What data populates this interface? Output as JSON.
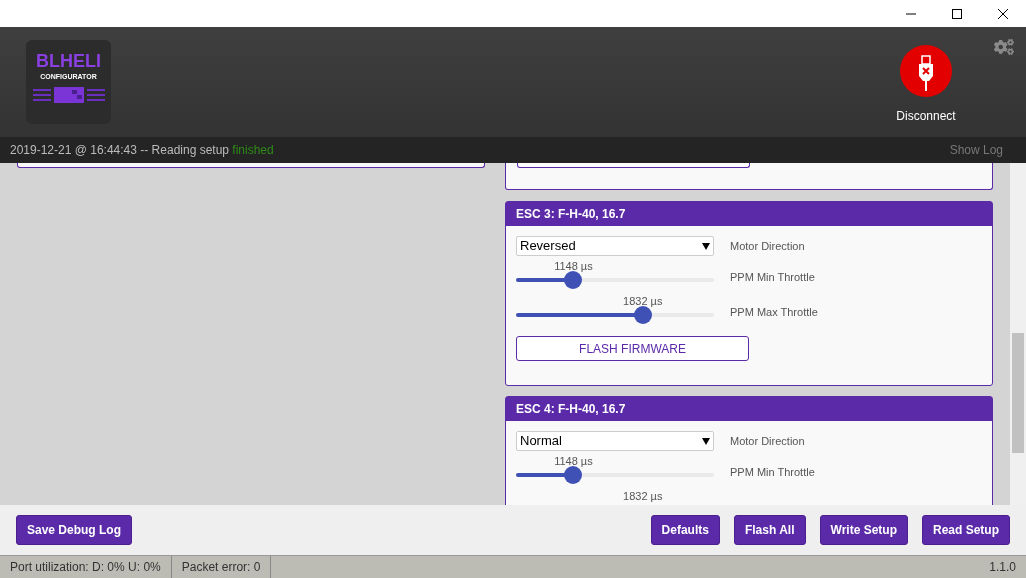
{
  "header": {
    "logo": {
      "title": "BLHELI",
      "subtitle": "CONFIGURATOR"
    },
    "connect_button": {
      "label": "Disconnect",
      "connected": true
    }
  },
  "log_bar": {
    "timestamp": "2019-12-21 @ 16:44:43",
    "message": "-- Reading setup",
    "status": "finished",
    "show_log": "Show Log"
  },
  "escs": [
    {
      "title": "ESC 3: F-H-40, 16.7",
      "direction": {
        "value": "Reversed",
        "label": "Motor Direction"
      },
      "sliders": [
        {
          "reading": "1148 µs",
          "label": "PPM Min Throttle",
          "level": 0.29
        },
        {
          "reading": "1832 µs",
          "label": "PPM Max Throttle",
          "level": 0.64
        }
      ],
      "flash_button": "FLASH FIRMWARE"
    },
    {
      "title": "ESC 4: F-H-40, 16.7",
      "direction": {
        "value": "Normal",
        "label": "Motor Direction"
      },
      "sliders": [
        {
          "reading": "1148 µs",
          "label": "PPM Min Throttle",
          "level": 0.29
        },
        {
          "reading": "1832 µs"
        }
      ]
    }
  ],
  "toolbar": {
    "left": [
      "Save Debug Log"
    ],
    "right": [
      "Defaults",
      "Flash All",
      "Write Setup",
      "Read Setup"
    ]
  },
  "status_bar": {
    "port_utilization": "Port utilization: D: 0% U: 0%",
    "packet_error": "Packet error: 0",
    "version": "1.1.0"
  }
}
